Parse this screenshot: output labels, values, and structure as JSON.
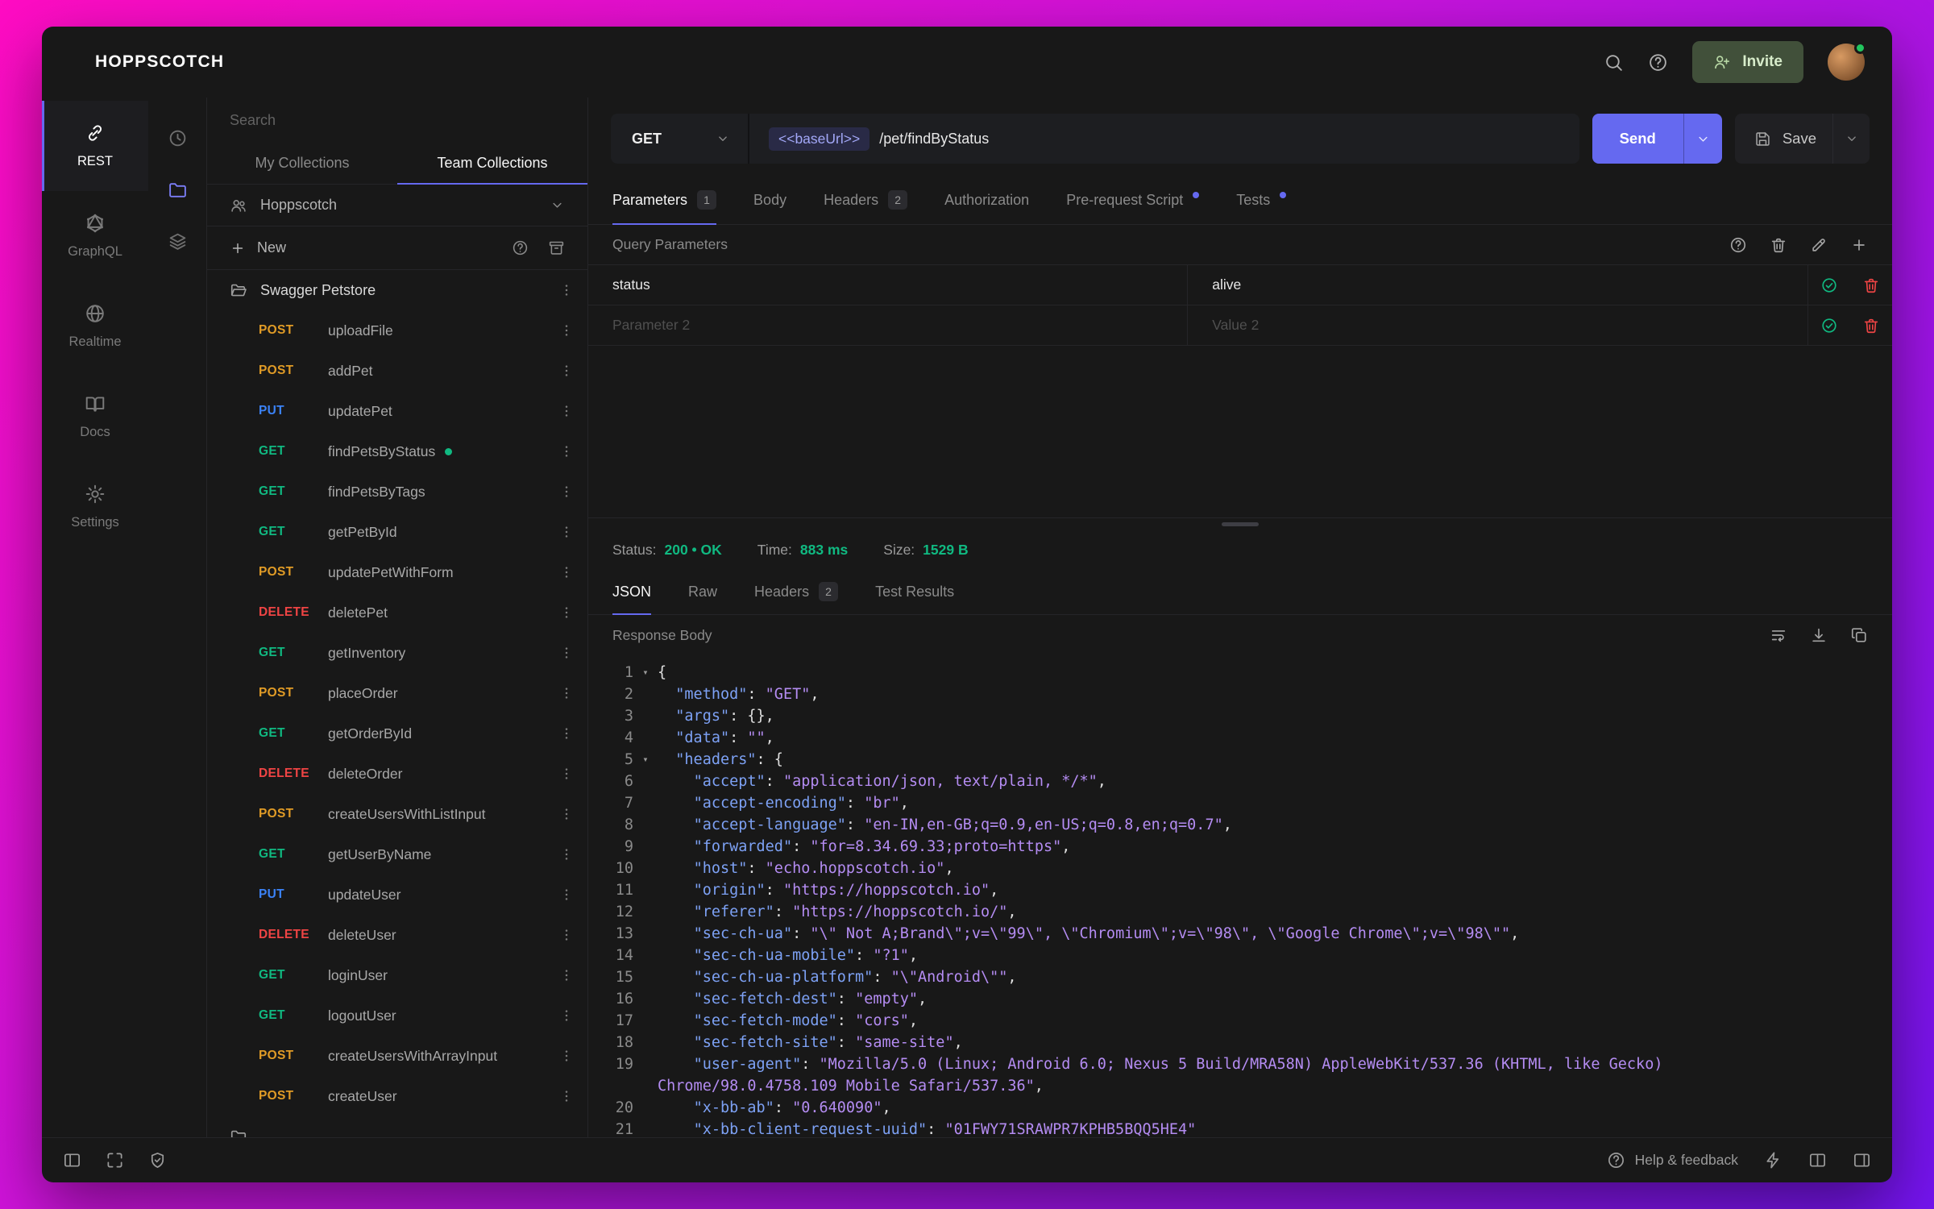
{
  "app": {
    "title": "HOPPSCOTCH",
    "topbar": {
      "invite_label": "Invite"
    }
  },
  "primary_nav": [
    {
      "id": "rest",
      "label": "REST",
      "icon": "link",
      "active": true
    },
    {
      "id": "graphql",
      "label": "GraphQL",
      "icon": "graphql",
      "active": false
    },
    {
      "id": "realtime",
      "label": "Realtime",
      "icon": "globe",
      "active": false
    },
    {
      "id": "docs",
      "label": "Docs",
      "icon": "book",
      "active": false
    },
    {
      "id": "settings",
      "label": "Settings",
      "icon": "gear",
      "active": false
    }
  ],
  "collections_nav": [
    {
      "id": "history",
      "icon": "clock",
      "active": false
    },
    {
      "id": "collections",
      "icon": "folder",
      "active": true
    },
    {
      "id": "environments",
      "icon": "layers",
      "active": false
    }
  ],
  "collections": {
    "search_placeholder": "Search",
    "tabs": [
      {
        "label": "My Collections",
        "active": false
      },
      {
        "label": "Team Collections",
        "active": true
      }
    ],
    "team_name": "Hoppscotch",
    "new_label": "New",
    "folder_name": "Swagger Petstore",
    "method_colors": {
      "GET": "#10b981",
      "POST": "#e09b26",
      "PUT": "#3b82f6",
      "DELETE": "#ef4444"
    },
    "requests": [
      {
        "method": "POST",
        "name": "uploadFile"
      },
      {
        "method": "POST",
        "name": "addPet"
      },
      {
        "method": "PUT",
        "name": "updatePet"
      },
      {
        "method": "GET",
        "name": "findPetsByStatus",
        "selected": true
      },
      {
        "method": "GET",
        "name": "findPetsByTags"
      },
      {
        "method": "GET",
        "name": "getPetById"
      },
      {
        "method": "POST",
        "name": "updatePetWithForm"
      },
      {
        "method": "DELETE",
        "name": "deletePet"
      },
      {
        "method": "GET",
        "name": "getInventory"
      },
      {
        "method": "POST",
        "name": "placeOrder"
      },
      {
        "method": "GET",
        "name": "getOrderById"
      },
      {
        "method": "DELETE",
        "name": "deleteOrder"
      },
      {
        "method": "POST",
        "name": "createUsersWithListInput"
      },
      {
        "method": "GET",
        "name": "getUserByName"
      },
      {
        "method": "PUT",
        "name": "updateUser"
      },
      {
        "method": "DELETE",
        "name": "deleteUser"
      },
      {
        "method": "GET",
        "name": "loginUser"
      },
      {
        "method": "GET",
        "name": "logoutUser"
      },
      {
        "method": "POST",
        "name": "createUsersWithArrayInput"
      },
      {
        "method": "POST",
        "name": "createUser"
      }
    ]
  },
  "request": {
    "method": "GET",
    "url_base": "<<baseUrl>>",
    "url_path": "/pet/findByStatus",
    "send_label": "Send",
    "save_label": "Save",
    "tabs": [
      {
        "label": "Parameters",
        "badge": "1",
        "active": true
      },
      {
        "label": "Body"
      },
      {
        "label": "Headers",
        "badge": "2"
      },
      {
        "label": "Authorization"
      },
      {
        "label": "Pre-request Script",
        "dot": true
      },
      {
        "label": "Tests",
        "dot": true
      }
    ],
    "section_title": "Query Parameters",
    "params": [
      {
        "key": "status",
        "value": "alive",
        "is_placeholder": false
      },
      {
        "key": "Parameter 2",
        "value": "Value 2",
        "is_placeholder": true
      }
    ]
  },
  "response": {
    "meta": [
      {
        "label": "Status:",
        "value": "200 • OK"
      },
      {
        "label": "Time:",
        "value": "883 ms"
      },
      {
        "label": "Size:",
        "value": "1529 B"
      }
    ],
    "tabs": [
      {
        "label": "JSON",
        "active": true
      },
      {
        "label": "Raw"
      },
      {
        "label": "Headers",
        "badge": "2"
      },
      {
        "label": "Test Results"
      }
    ],
    "body_title": "Response Body",
    "code": [
      {
        "n": "1",
        "ind": 0,
        "fold": true,
        "tok": [
          [
            "p",
            "{"
          ]
        ]
      },
      {
        "n": "2",
        "ind": 1,
        "tok": [
          [
            "k",
            "\"method\""
          ],
          [
            "p",
            ": "
          ],
          [
            "s",
            "\"GET\""
          ],
          [
            "p",
            ","
          ]
        ]
      },
      {
        "n": "3",
        "ind": 1,
        "tok": [
          [
            "k",
            "\"args\""
          ],
          [
            "p",
            ": {},"
          ]
        ]
      },
      {
        "n": "4",
        "ind": 1,
        "tok": [
          [
            "k",
            "\"data\""
          ],
          [
            "p",
            ": "
          ],
          [
            "s",
            "\"\""
          ],
          [
            "p",
            ","
          ]
        ]
      },
      {
        "n": "5",
        "ind": 1,
        "fold": true,
        "tok": [
          [
            "k",
            "\"headers\""
          ],
          [
            "p",
            ": {"
          ]
        ]
      },
      {
        "n": "6",
        "ind": 2,
        "tok": [
          [
            "k",
            "\"accept\""
          ],
          [
            "p",
            ": "
          ],
          [
            "s",
            "\"application/json, text/plain, */*\""
          ],
          [
            "p",
            ","
          ]
        ]
      },
      {
        "n": "7",
        "ind": 2,
        "tok": [
          [
            "k",
            "\"accept-encoding\""
          ],
          [
            "p",
            ": "
          ],
          [
            "s",
            "\"br\""
          ],
          [
            "p",
            ","
          ]
        ]
      },
      {
        "n": "8",
        "ind": 2,
        "tok": [
          [
            "k",
            "\"accept-language\""
          ],
          [
            "p",
            ": "
          ],
          [
            "s",
            "\"en-IN,en-GB;q=0.9,en-US;q=0.8,en;q=0.7\""
          ],
          [
            "p",
            ","
          ]
        ]
      },
      {
        "n": "9",
        "ind": 2,
        "tok": [
          [
            "k",
            "\"forwarded\""
          ],
          [
            "p",
            ": "
          ],
          [
            "s",
            "\"for=8.34.69.33;proto=https\""
          ],
          [
            "p",
            ","
          ]
        ]
      },
      {
        "n": "10",
        "ind": 2,
        "tok": [
          [
            "k",
            "\"host\""
          ],
          [
            "p",
            ": "
          ],
          [
            "s",
            "\"echo.hoppscotch.io\""
          ],
          [
            "p",
            ","
          ]
        ]
      },
      {
        "n": "11",
        "ind": 2,
        "tok": [
          [
            "k",
            "\"origin\""
          ],
          [
            "p",
            ": "
          ],
          [
            "s",
            "\"https://hoppscotch.io\""
          ],
          [
            "p",
            ","
          ]
        ]
      },
      {
        "n": "12",
        "ind": 2,
        "tok": [
          [
            "k",
            "\"referer\""
          ],
          [
            "p",
            ": "
          ],
          [
            "s",
            "\"https://hoppscotch.io/\""
          ],
          [
            "p",
            ","
          ]
        ]
      },
      {
        "n": "13",
        "ind": 2,
        "tok": [
          [
            "k",
            "\"sec-ch-ua\""
          ],
          [
            "p",
            ": "
          ],
          [
            "s",
            "\"\\\" Not A;Brand\\\";v=\\\"99\\\", \\\"Chromium\\\";v=\\\"98\\\", \\\"Google Chrome\\\";v=\\\"98\\\"\""
          ],
          [
            "p",
            ","
          ]
        ]
      },
      {
        "n": "14",
        "ind": 2,
        "tok": [
          [
            "k",
            "\"sec-ch-ua-mobile\""
          ],
          [
            "p",
            ": "
          ],
          [
            "s",
            "\"?1\""
          ],
          [
            "p",
            ","
          ]
        ]
      },
      {
        "n": "15",
        "ind": 2,
        "tok": [
          [
            "k",
            "\"sec-ch-ua-platform\""
          ],
          [
            "p",
            ": "
          ],
          [
            "s",
            "\"\\\"Android\\\"\""
          ],
          [
            "p",
            ","
          ]
        ]
      },
      {
        "n": "16",
        "ind": 2,
        "tok": [
          [
            "k",
            "\"sec-fetch-dest\""
          ],
          [
            "p",
            ": "
          ],
          [
            "s",
            "\"empty\""
          ],
          [
            "p",
            ","
          ]
        ]
      },
      {
        "n": "17",
        "ind": 2,
        "tok": [
          [
            "k",
            "\"sec-fetch-mode\""
          ],
          [
            "p",
            ": "
          ],
          [
            "s",
            "\"cors\""
          ],
          [
            "p",
            ","
          ]
        ]
      },
      {
        "n": "18",
        "ind": 2,
        "tok": [
          [
            "k",
            "\"sec-fetch-site\""
          ],
          [
            "p",
            ": "
          ],
          [
            "s",
            "\"same-site\""
          ],
          [
            "p",
            ","
          ]
        ]
      },
      {
        "n": "19",
        "ind": 2,
        "tok": [
          [
            "k",
            "\"user-agent\""
          ],
          [
            "p",
            ": "
          ],
          [
            "s",
            "\"Mozilla/5.0 (Linux; Android 6.0; Nexus 5 Build/MRA58N) AppleWebKit/537.36 (KHTML, like Gecko)"
          ]
        ]
      },
      {
        "cont": true,
        "ind": 0,
        "tok": [
          [
            "s",
            "Chrome/98.0.4758.109 Mobile Safari/537.36\""
          ],
          [
            "p",
            ","
          ]
        ]
      },
      {
        "n": "20",
        "ind": 2,
        "tok": [
          [
            "k",
            "\"x-bb-ab\""
          ],
          [
            "p",
            ": "
          ],
          [
            "s",
            "\"0.640090\""
          ],
          [
            "p",
            ","
          ]
        ]
      },
      {
        "n": "21",
        "ind": 2,
        "tok": [
          [
            "k",
            "\"x-bb-client-request-uuid\""
          ],
          [
            "p",
            ": "
          ],
          [
            "s",
            "\"01FWY71SRAWPR7KPHB5BQQ5HE4\""
          ]
        ]
      }
    ]
  },
  "footer": {
    "help_label": "Help & feedback"
  },
  "colors": {
    "accent": "#6569f0",
    "success": "#10b981",
    "danger": "#ef4444"
  }
}
